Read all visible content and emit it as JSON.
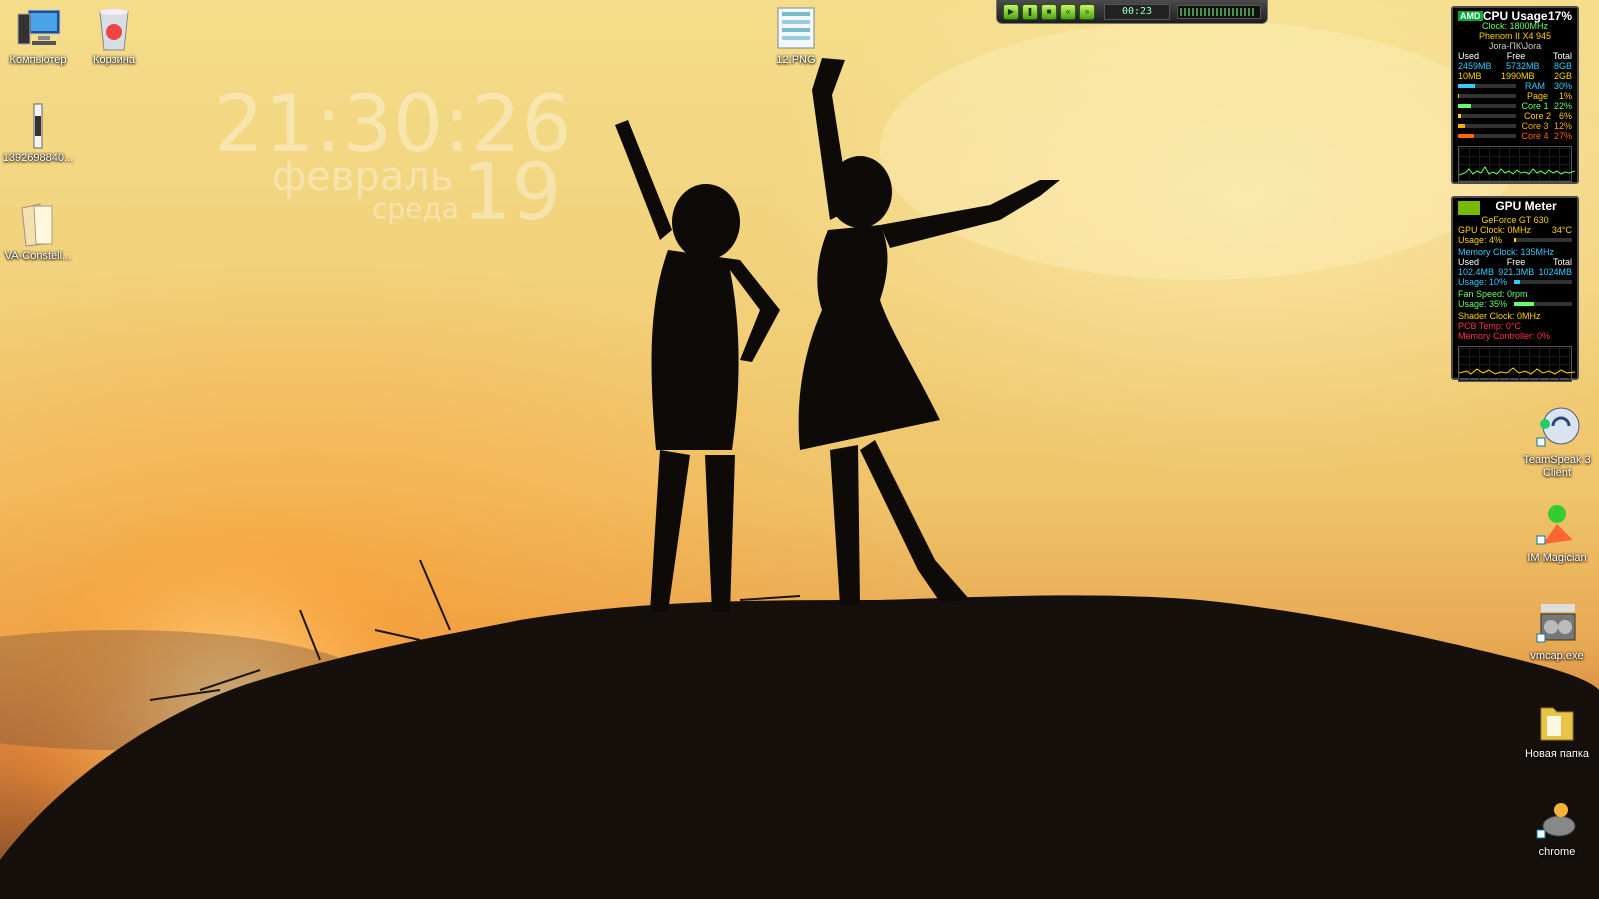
{
  "desktop": {
    "icons_left": [
      {
        "label": "Компьютер",
        "icon": "computer-icon"
      },
      {
        "label": "Корзина",
        "icon": "recycle-bin-icon"
      },
      {
        "label": "1392698840...",
        "icon": "image-file-icon"
      },
      {
        "label": "VA-Constell...",
        "icon": "folder-icon"
      },
      {
        "label": "12.PNG",
        "icon": "png-file-icon"
      }
    ],
    "icons_right": [
      {
        "label": "TeamSpeak 3 Client",
        "icon": "teamspeak-icon"
      },
      {
        "label": "IM Magician",
        "icon": "im-magician-icon"
      },
      {
        "label": "vmcap.exe",
        "icon": "vmcap-icon"
      },
      {
        "label": "Новая папка",
        "icon": "folder-icon"
      },
      {
        "label": "chrome",
        "icon": "chrome-icon"
      }
    ]
  },
  "clock": {
    "time": "21:30:26",
    "month": "февраль",
    "day": "19",
    "weekday": "среда"
  },
  "player": {
    "time": "00:23",
    "buttons": [
      "play",
      "pause",
      "stop",
      "prev",
      "next"
    ]
  },
  "cpu_gadget": {
    "brand": "AMD",
    "title": "CPU Usage",
    "usage": "17%",
    "clock": "Clock: 1800MHz",
    "cpu_name": "Phenom II X4 945",
    "host": "Jora-ПК\\Jora",
    "headers": [
      "Used",
      "Free",
      "Total"
    ],
    "ram_row": [
      "2459MB",
      "5732MB",
      "8GB"
    ],
    "page_row": [
      "10MB",
      "1990MB",
      "2GB"
    ],
    "meters": [
      {
        "label": "RAM",
        "value": "30%",
        "fill": 0.3,
        "color": "#3cf"
      },
      {
        "label": "Page",
        "value": "1%",
        "fill": 0.01,
        "color": "#ffd200"
      },
      {
        "label": "Core 1",
        "value": "22%",
        "fill": 0.22,
        "color": "#6f6"
      },
      {
        "label": "Core 2",
        "value": "6%",
        "fill": 0.06,
        "color": "#ffd200"
      },
      {
        "label": "Core 3",
        "value": "12%",
        "fill": 0.12,
        "color": "#fa0"
      },
      {
        "label": "Core 4",
        "value": "27%",
        "fill": 0.27,
        "color": "#f60"
      }
    ]
  },
  "gpu_gadget": {
    "title": "GPU Meter",
    "gpu_name": "GeForce GT 630",
    "gpu_clock": "GPU Clock: 0MHz",
    "temp": "34°C",
    "usage": "Usage: 4%",
    "usage_fill": 0.04,
    "memory_clock": "Memory Clock: 135MHz",
    "mem_headers": [
      "Used",
      "Free",
      "Total"
    ],
    "mem_row": [
      "102.4MB",
      "921.3MB",
      "1024MB"
    ],
    "mem_usage": "Usage: 10%",
    "mem_usage_fill": 0.1,
    "fan_speed": "Fan Speed: 0rpm",
    "fan_usage": "Usage: 35%",
    "fan_usage_fill": 0.35,
    "shader_clock": "Shader Clock: 0MHz",
    "pcb_temp": "PCB Temp: 0°C",
    "memory_controller": "Memory Controller: 0%"
  }
}
